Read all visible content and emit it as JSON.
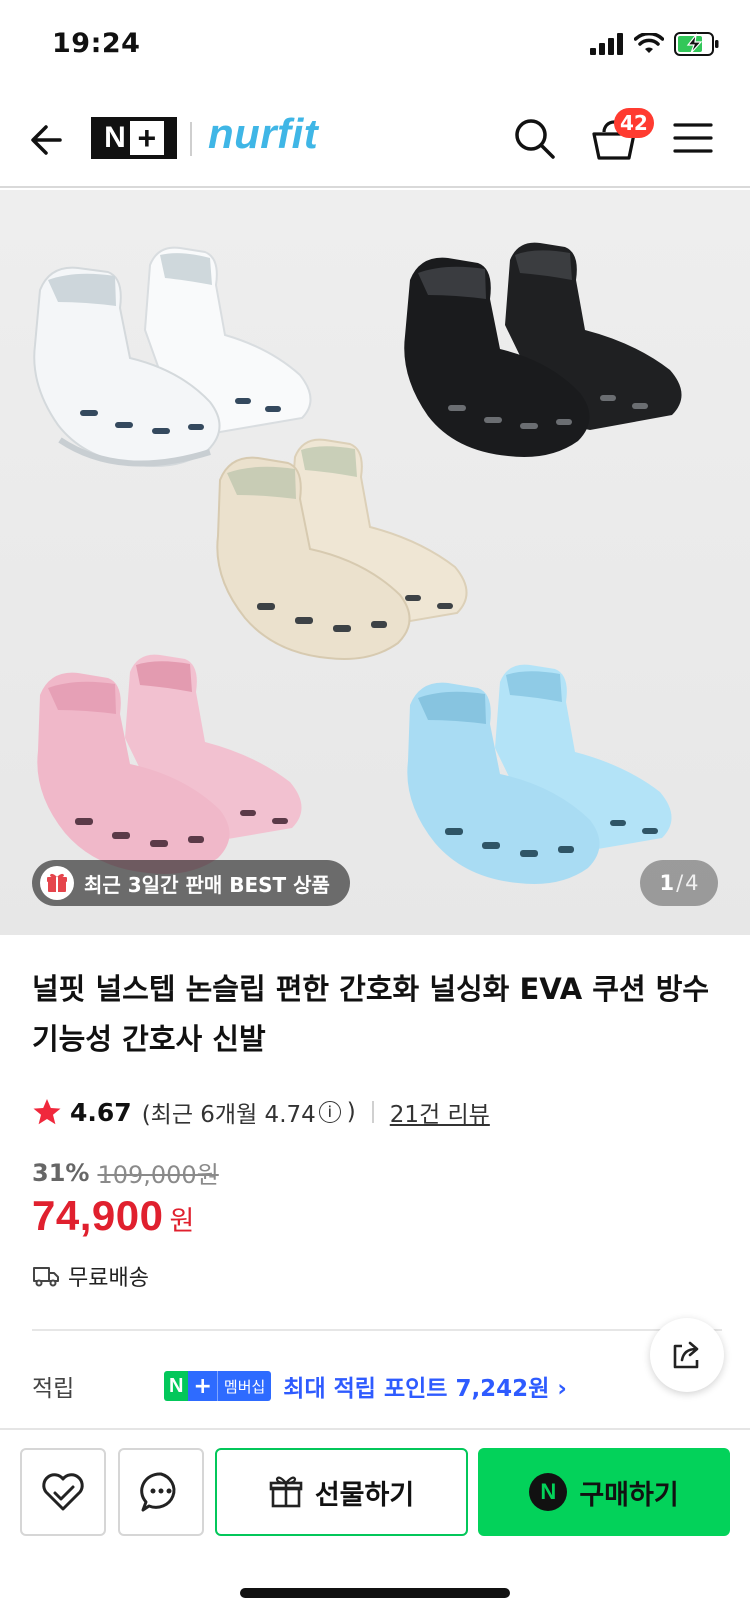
{
  "status_bar": {
    "time": "19:24"
  },
  "header": {
    "brand_badge_n": "N",
    "brand_badge_plus": "+",
    "brand_name": "nurfit",
    "cart_count": "42",
    "accent_color": "#3fb6e6"
  },
  "gallery": {
    "best_badge": "최근 3일간 판매 BEST 상품",
    "page_current": "1",
    "page_separator": "/",
    "page_total": "4",
    "shoe_colors": [
      "#f7f8f9",
      "#1c1c1e",
      "#ece3d2",
      "#f2bfcf",
      "#aee0f6"
    ]
  },
  "product": {
    "title": "널핏 널스텝 논슬립 편한 간호화 널싱화 EVA 쿠션 방수 기능성 간호사 신발",
    "rating": "4.67",
    "rating_recent_open": "(최근 6개월 4.74",
    "rating_recent_close": ")",
    "info_glyph": "i",
    "review_link": "21건 리뷰",
    "discount_rate": "31%",
    "original_price": "109,000원",
    "sale_price": "74,900",
    "sale_unit": "원",
    "delivery": "무료배송",
    "points_label": "적립",
    "np_n": "N",
    "np_plus": "+",
    "np_member": "멤버십",
    "points_text": "최대 적립 포인트 7,242원 ›",
    "price_color": "#e0202e"
  },
  "bottom_bar": {
    "gift_label": "선물하기",
    "buy_n": "N",
    "buy_label": "구매하기",
    "buy_color": "#03d25a"
  }
}
